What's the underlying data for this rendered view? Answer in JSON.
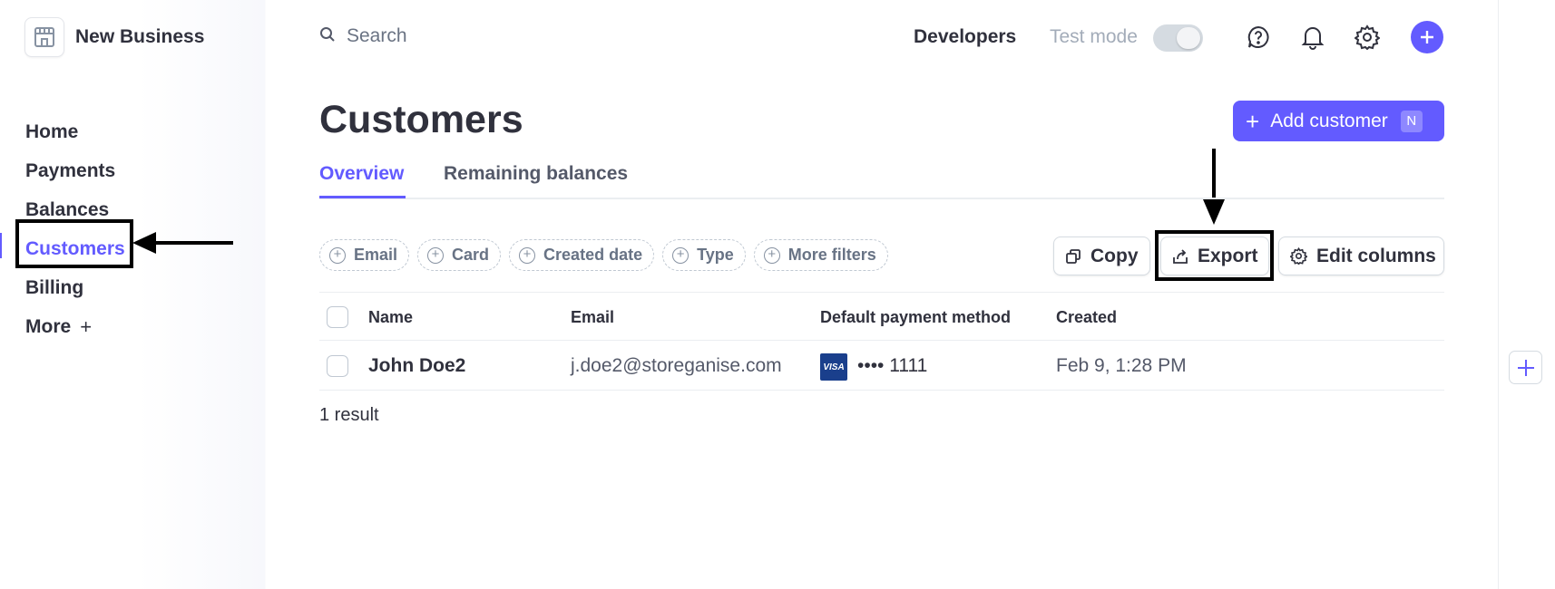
{
  "account": {
    "name": "New Business",
    "logo_icon": "storefront-icon"
  },
  "sidebar": {
    "items": [
      {
        "label": "Home"
      },
      {
        "label": "Payments"
      },
      {
        "label": "Balances"
      },
      {
        "label": "Customers",
        "active": true
      },
      {
        "label": "Billing"
      },
      {
        "label": "More",
        "suffix": "+"
      }
    ]
  },
  "topbar": {
    "search_placeholder": "Search",
    "developers_label": "Developers",
    "test_mode_label": "Test mode",
    "test_mode_on": false,
    "icons": [
      "help-icon",
      "bell-icon",
      "gear-icon",
      "plus-icon"
    ]
  },
  "page": {
    "title": "Customers",
    "add_button_label": "Add customer",
    "add_button_shortcut": "N",
    "tabs": [
      {
        "label": "Overview",
        "active": true
      },
      {
        "label": "Remaining balances",
        "active": false
      }
    ],
    "filters": [
      "Email",
      "Card",
      "Created date",
      "Type",
      "More filters"
    ],
    "actions": {
      "copy": "Copy",
      "export": "Export",
      "edit_columns": "Edit columns"
    }
  },
  "table": {
    "columns": [
      "Name",
      "Email",
      "Default payment method",
      "Created"
    ],
    "rows": [
      {
        "name": "John Doe2",
        "email": "j.doe2@storeganise.com",
        "card_brand": "VISA",
        "card_last4": "•••• 1111",
        "created": "Feb 9, 1:28 PM"
      }
    ],
    "result_count": "1 result"
  },
  "colors": {
    "accent": "#635bff",
    "text": "#30313d",
    "muted": "#687385",
    "visa": "#1a3f8c"
  }
}
